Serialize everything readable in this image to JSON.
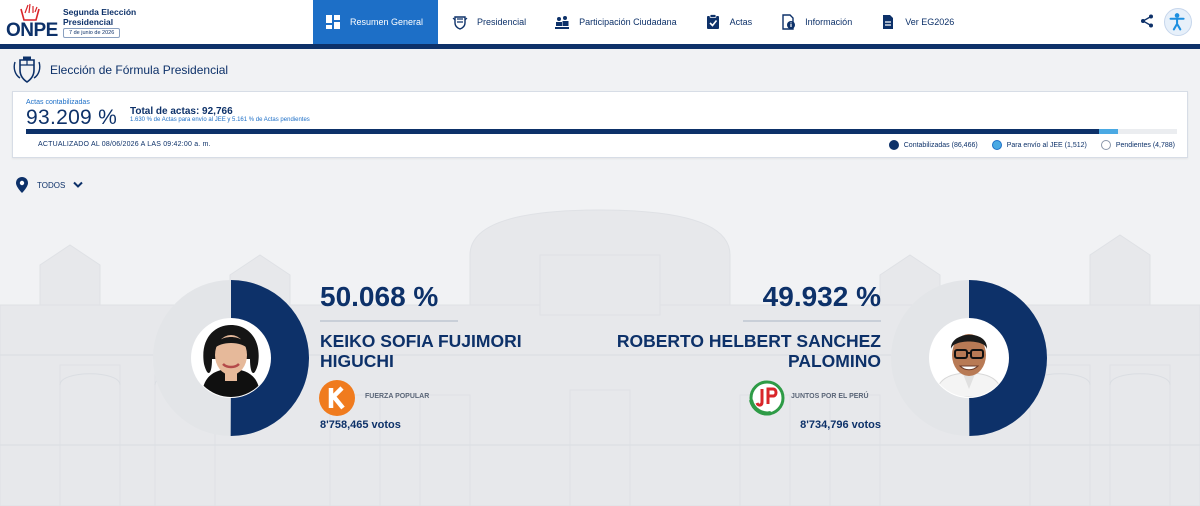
{
  "header": {
    "logo_text": "ONPE",
    "election_title": "Segunda Elección Presidencial",
    "election_date": "7 de junio de 2026",
    "nav": [
      {
        "label": "Resumen General",
        "icon": "dashboard-icon",
        "active": true
      },
      {
        "label": "Presidencial",
        "icon": "peru-shield-icon"
      },
      {
        "label": "Participación Ciudadana",
        "icon": "people-icon"
      },
      {
        "label": "Actas",
        "icon": "checked-document-icon"
      },
      {
        "label": "Información",
        "icon": "info-document-icon"
      },
      {
        "label": "Ver EG2026",
        "icon": "document-icon"
      }
    ]
  },
  "page": {
    "title": "Elección de Fórmula Presidencial"
  },
  "progress": {
    "label": "Actas contabilizadas",
    "percent": "93.209 %",
    "total": "Total de actas: 92,766",
    "note": "1.630 % de Actas para envío al JEE y 5.161 % de Actas pendientes",
    "updated": "ACTUALIZADO AL 08/06/2026 A LAS 09:42:00 a. m.",
    "counted_fraction": 0.93209,
    "jee_fraction": 0.0163,
    "legend": [
      {
        "label": "Contabilizadas (86,466)",
        "color": "#0d3169",
        "kind": "filled"
      },
      {
        "label": "Para envío al JEE (1,512)",
        "color": "#4aa9e3",
        "kind": "filled"
      },
      {
        "label": "Pendientes (4,788)",
        "color": "#ffffff",
        "kind": "hollow"
      }
    ]
  },
  "filter": {
    "label": "TODOS"
  },
  "candidates": [
    {
      "percent": "50.068 %",
      "share": 0.50068,
      "name_line1": "KEIKO SOFIA FUJIMORI",
      "name_line2": "HIGUCHI",
      "party": "FUERZA POPULAR",
      "party_logo_letter": "K",
      "votes": "8'758,465 votos"
    },
    {
      "percent": "49.932 %",
      "share": 0.49932,
      "name_line1": "ROBERTO HELBERT SANCHEZ",
      "name_line2": "PALOMINO",
      "party": "JUNTOS POR EL PERÚ",
      "party_logo_letter": "JP",
      "votes": "8'734,796 votos"
    }
  ],
  "colors": {
    "brand_navy": "#0d3169",
    "active_blue": "#1d6fc7",
    "jee_blue": "#4aa9e3",
    "donut_rest": "#e3e5e8",
    "fuerza_popular_orange": "#f07b1e",
    "juntos_green": "#2e9b46",
    "juntos_red": "#d9252a"
  }
}
